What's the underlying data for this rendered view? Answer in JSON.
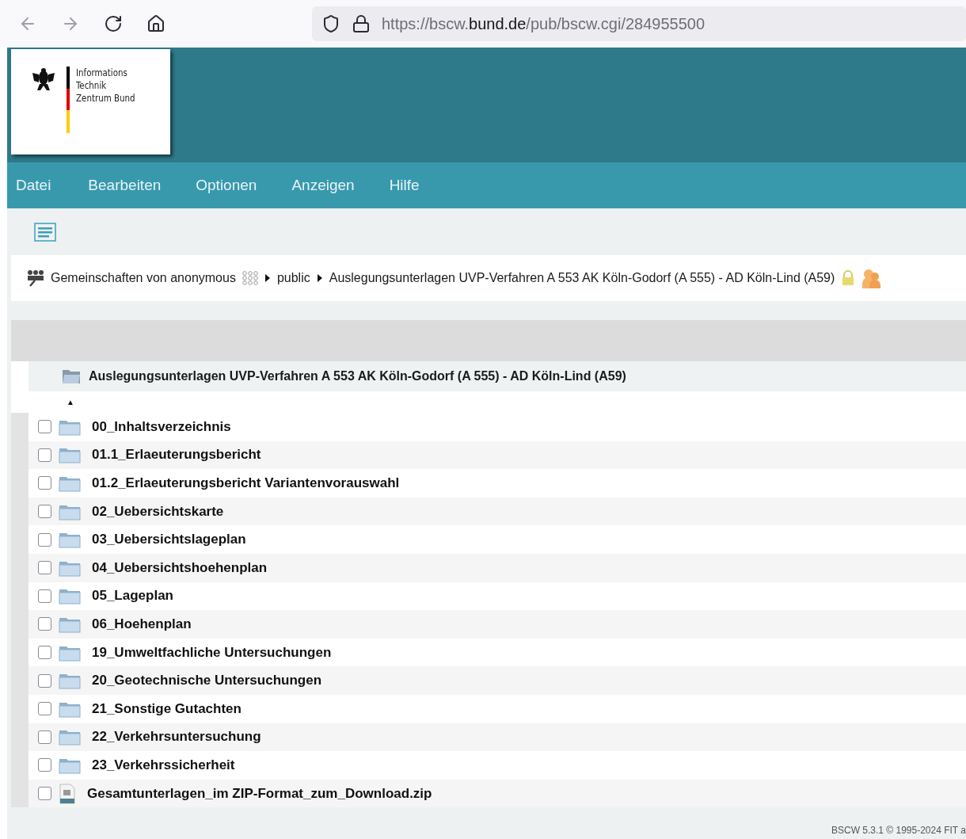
{
  "browser": {
    "url": {
      "prefix": "https://bscw.",
      "domain": "bund.de",
      "path": "/pub/bscw.cgi/284955500"
    }
  },
  "logo": {
    "lines": [
      "Informations",
      "Technik",
      "Zentrum Bund"
    ]
  },
  "menu": [
    "Datei",
    "Bearbeiten",
    "Optionen",
    "Anzeigen",
    "Hilfe"
  ],
  "breadcrumb": [
    {
      "label": "Gemeinschaften von anonymous",
      "kind": "community"
    },
    {
      "label": "public",
      "kind": "folder"
    },
    {
      "label": "Auslegungsunterlagen UVP-Verfahren A 553 AK Köln-Godorf (A 555) - AD Köln-Lind (A59)",
      "kind": "current"
    }
  ],
  "table": {
    "title": "Auslegungsunterlagen UVP-Verfahren A 553 AK Köln-Godorf (A 555) - AD Köln-Lind (A59)",
    "sort_mark": "▲",
    "rows": [
      {
        "name": "00_Inhaltsverzeichnis",
        "kind": "folder",
        "checked": false
      },
      {
        "name": "01.1_Erlaeuterungsbericht",
        "kind": "folder",
        "checked": false
      },
      {
        "name": "01.2_Erlaeuterungsbericht Variantenvorauswahl",
        "kind": "folder",
        "checked": false
      },
      {
        "name": "02_Uebersichtskarte",
        "kind": "folder",
        "checked": false
      },
      {
        "name": "03_Uebersichtslageplan",
        "kind": "folder",
        "checked": false
      },
      {
        "name": "04_Uebersichtshoehenplan",
        "kind": "folder",
        "checked": false
      },
      {
        "name": "05_Lageplan",
        "kind": "folder",
        "checked": false
      },
      {
        "name": "06_Hoehenplan",
        "kind": "folder",
        "checked": false
      },
      {
        "name": "19_Umweltfachliche Untersuchungen",
        "kind": "folder",
        "checked": false
      },
      {
        "name": "20_Geotechnische Untersuchungen",
        "kind": "folder",
        "checked": false
      },
      {
        "name": "21_Sonstige Gutachten",
        "kind": "folder",
        "checked": false
      },
      {
        "name": "22_Verkehrsuntersuchung",
        "kind": "folder",
        "checked": false
      },
      {
        "name": "23_Verkehrssicherheit",
        "kind": "folder",
        "checked": false
      },
      {
        "name": "Gesamtunterlagen_im ZIP-Format_zum_Download.zip",
        "kind": "file",
        "checked": false
      }
    ]
  },
  "footer": "BSCW 5.3.1 © 1995-2024 FIT a"
}
